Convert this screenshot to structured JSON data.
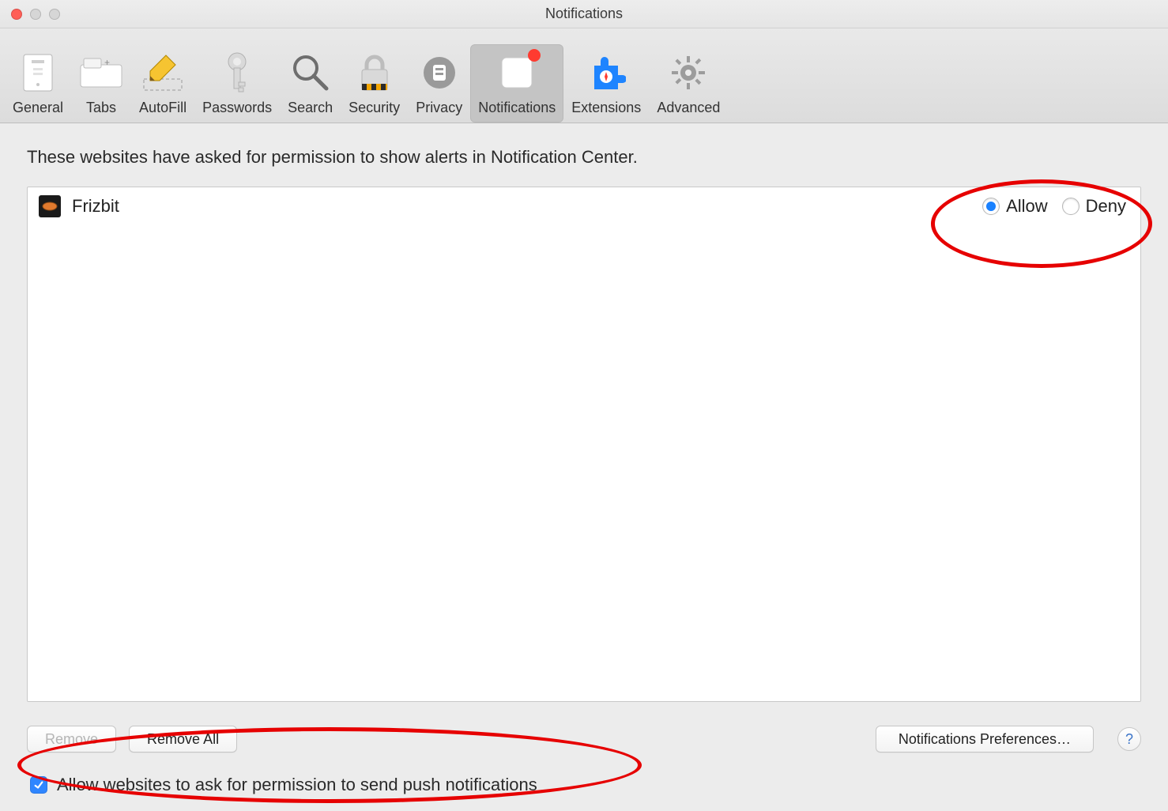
{
  "window": {
    "title": "Notifications"
  },
  "toolbar": {
    "items": [
      {
        "label": "General"
      },
      {
        "label": "Tabs"
      },
      {
        "label": "AutoFill"
      },
      {
        "label": "Passwords"
      },
      {
        "label": "Search"
      },
      {
        "label": "Security"
      },
      {
        "label": "Privacy"
      },
      {
        "label": "Notifications"
      },
      {
        "label": "Extensions"
      },
      {
        "label": "Advanced"
      }
    ],
    "selected_index": 7
  },
  "main": {
    "description": "These websites have asked for permission to show alerts in Notification Center.",
    "sites": [
      {
        "name": "Frizbit",
        "permission": "Allow"
      }
    ],
    "radio_labels": {
      "allow": "Allow",
      "deny": "Deny"
    }
  },
  "buttons": {
    "remove": "Remove",
    "remove_all": "Remove All",
    "notif_prefs": "Notifications Preferences…"
  },
  "footer": {
    "checkbox_checked": true,
    "label": "Allow websites to ask for permission to send push notifications"
  },
  "annotations": {
    "circle_radio_group": true,
    "circle_footer_checkbox": true
  }
}
